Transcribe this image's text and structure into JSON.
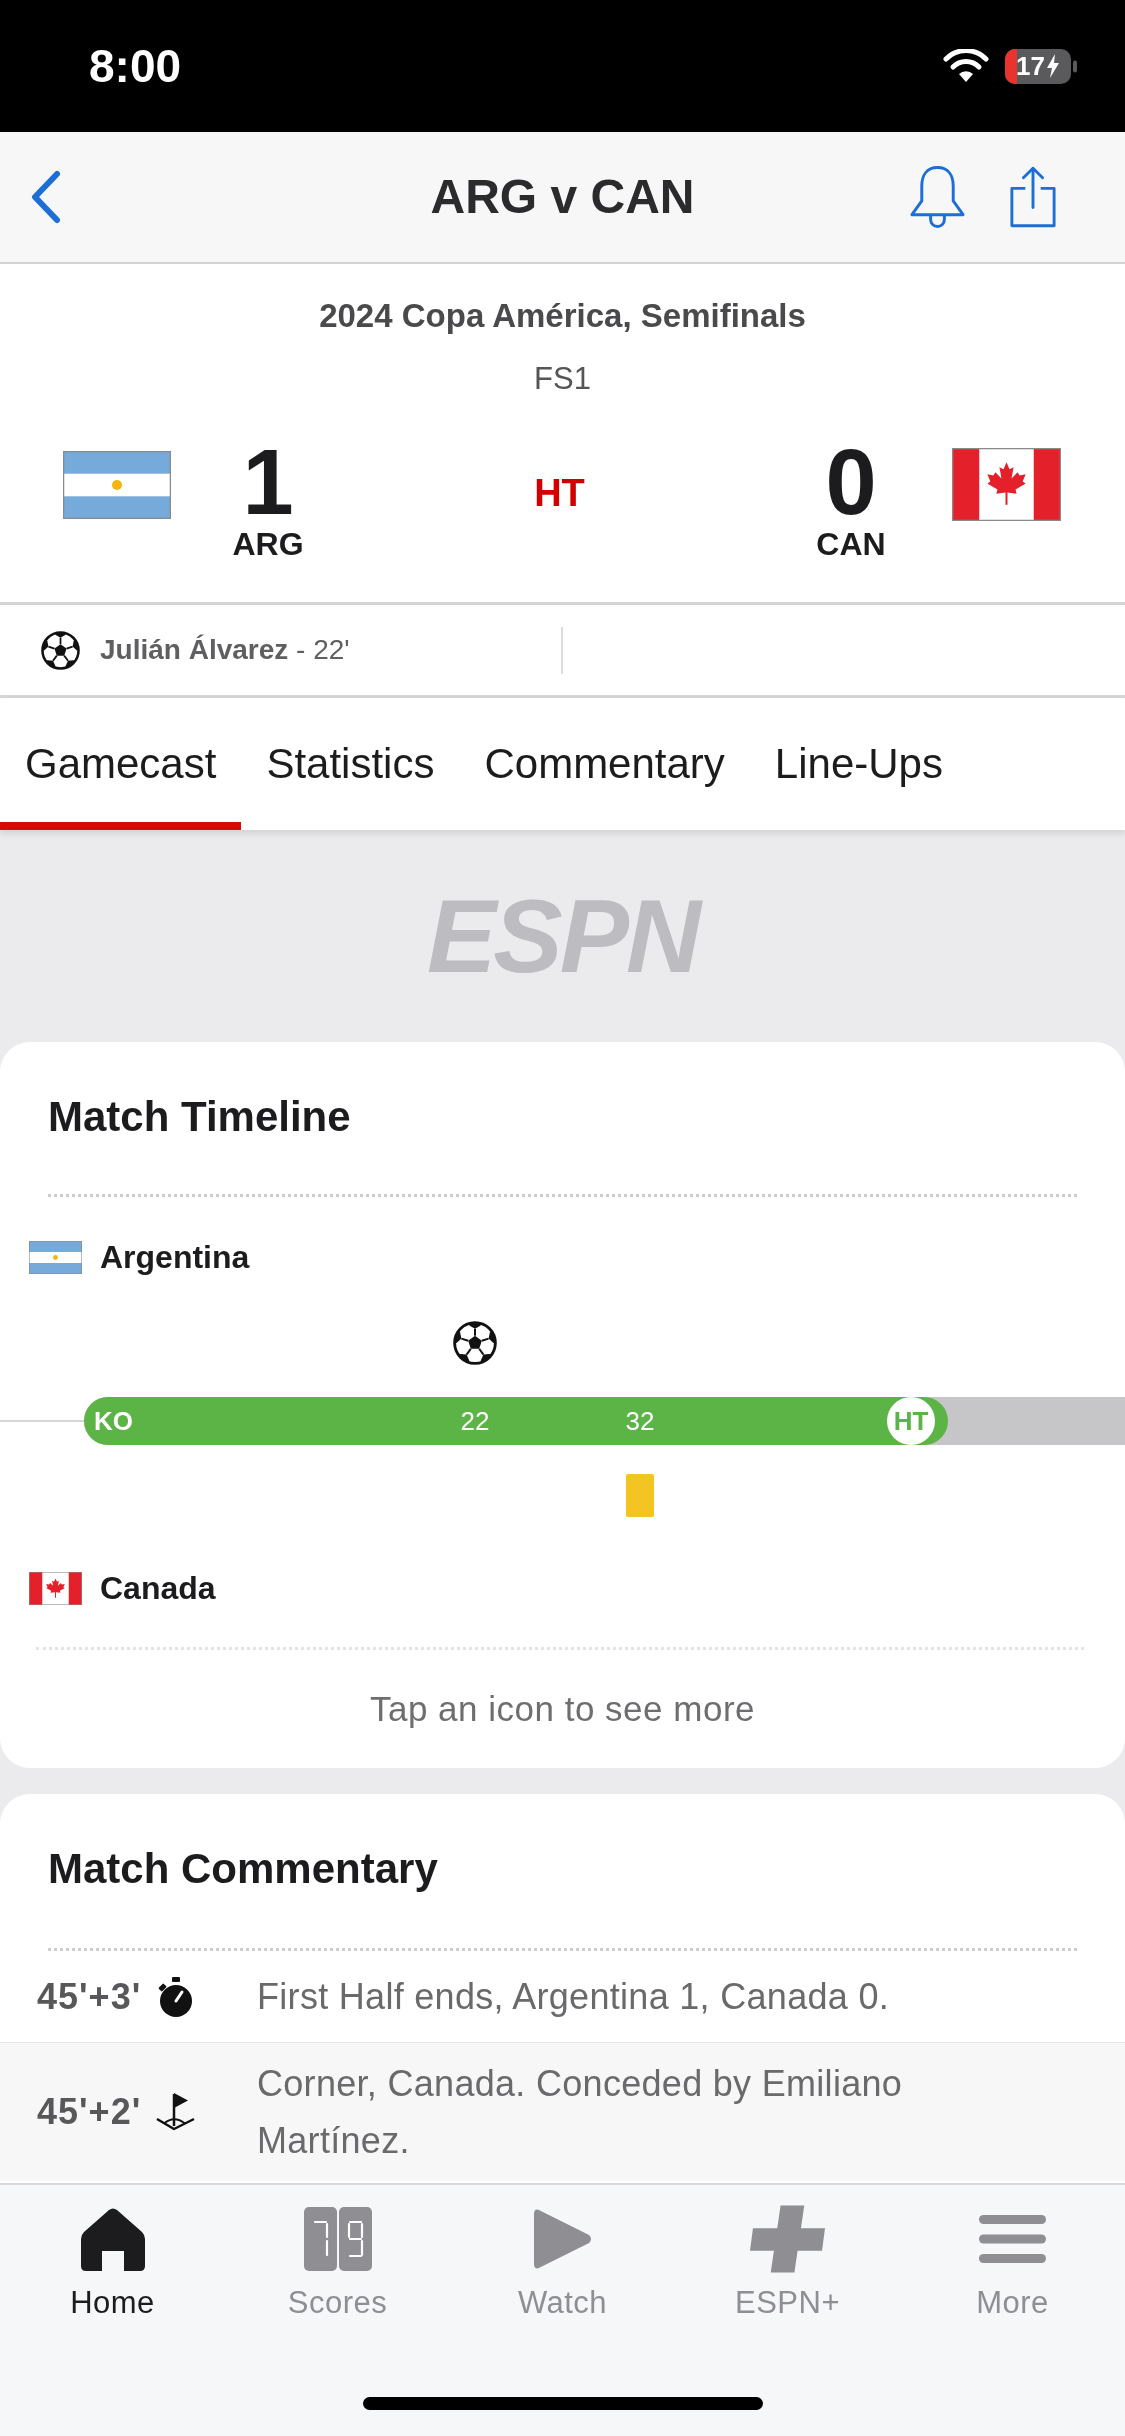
{
  "status_bar": {
    "time": "8:00",
    "battery": "17"
  },
  "nav": {
    "title": "ARG v CAN"
  },
  "match": {
    "competition": "2024 Copa América, Semifinals",
    "broadcast": "FS1",
    "status": "HT",
    "teams": [
      {
        "abbr": "ARG",
        "score": "1"
      },
      {
        "abbr": "CAN",
        "score": "0"
      }
    ],
    "scorers": [
      {
        "text": "**Julián Álvarez** - 22'"
      }
    ]
  },
  "tabs": [
    {
      "label": "Gamecast",
      "selected": true
    },
    {
      "label": "Statistics",
      "selected": false
    },
    {
      "label": "Commentary",
      "selected": false
    },
    {
      "label": "Line-Ups",
      "selected": false
    }
  ],
  "logo": "ESPN",
  "timeline": {
    "title": "Match Timeline",
    "start_label": "KO",
    "end_label": "HT",
    "level": 0.83,
    "teams": [
      {
        "name": "Argentina",
        "events": [
          {
            "kind": "goal",
            "minute": "22"
          }
        ]
      },
      {
        "name": "Canada",
        "events": [
          {
            "kind": "yellow_card",
            "minute": "32"
          }
        ]
      }
    ],
    "hint": "Tap an icon to see more"
  },
  "commentary": {
    "title": "Match Commentary",
    "entries": [
      {
        "time": "45'+3'",
        "kind": "period_end",
        "text": "First Half ends, Argentina 1, Canada 0."
      },
      {
        "time": "45'+2'",
        "kind": "corner",
        "text": "Corner, Canada. Conceded by Emiliano Martínez."
      }
    ]
  },
  "tab_bar": [
    {
      "label": "Home",
      "selected": true
    },
    {
      "label": "Scores",
      "selected": false
    },
    {
      "label": "Watch",
      "selected": false
    },
    {
      "label": "ESPN+",
      "selected": false
    },
    {
      "label": "More",
      "selected": false
    }
  ]
}
